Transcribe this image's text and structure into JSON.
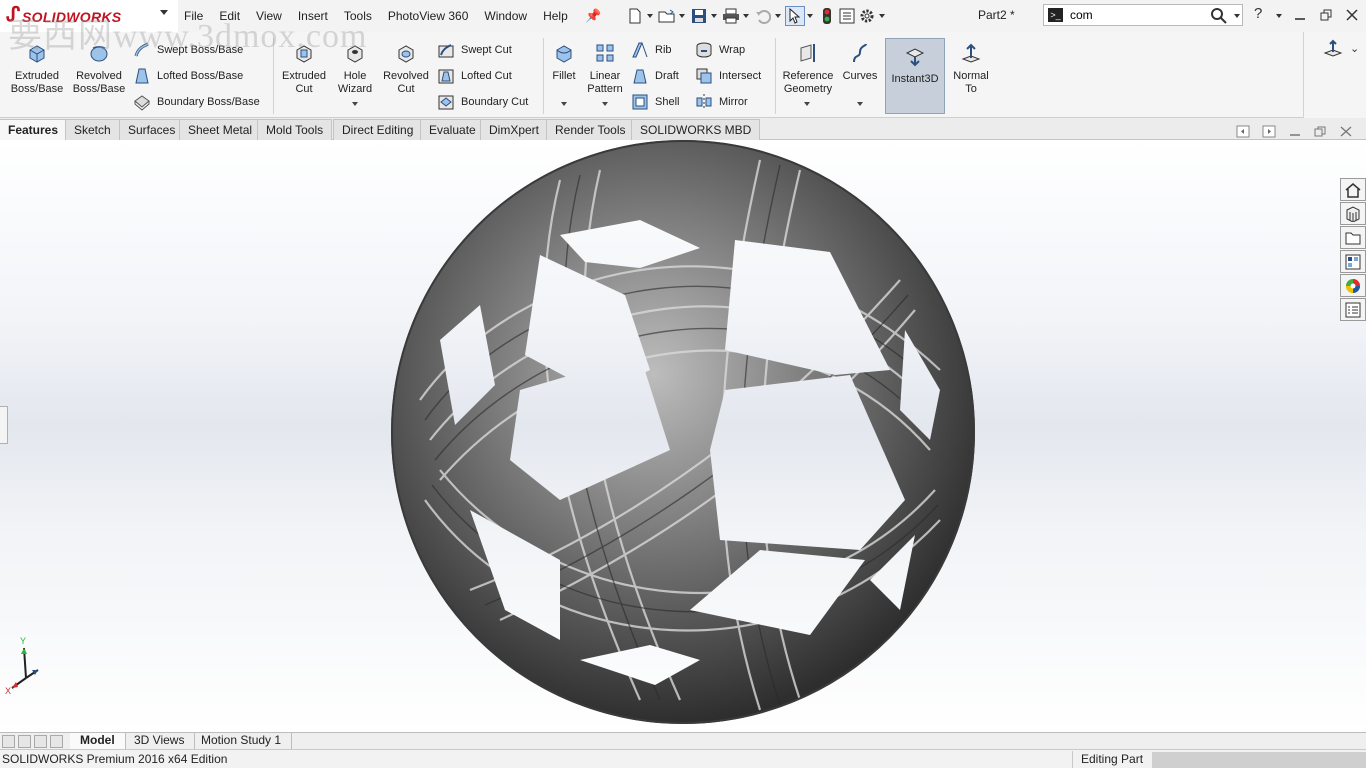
{
  "app": {
    "brand": "SOLIDWORKS",
    "menu": [
      "File",
      "Edit",
      "View",
      "Insert",
      "Tools",
      "PhotoView 360",
      "Window",
      "Help"
    ],
    "document_title": "Part2 *",
    "search_value": "com"
  },
  "ribbon": {
    "features": {
      "extruded_boss": "Extruded\nBoss/Base",
      "revolved_boss": "Revolved\nBoss/Base",
      "swept_boss": "Swept Boss/Base",
      "lofted_boss": "Lofted Boss/Base",
      "boundary_boss": "Boundary Boss/Base",
      "extruded_cut": "Extruded\nCut",
      "hole_wizard": "Hole\nWizard",
      "revolved_cut": "Revolved\nCut",
      "swept_cut": "Swept Cut",
      "lofted_cut": "Lofted Cut",
      "boundary_cut": "Boundary Cut",
      "fillet": "Fillet",
      "linear_pattern": "Linear\nPattern",
      "rib": "Rib",
      "draft": "Draft",
      "shell": "Shell",
      "wrap": "Wrap",
      "intersect": "Intersect",
      "mirror": "Mirror",
      "reference_geometry": "Reference\nGeometry",
      "curves": "Curves",
      "instant3d": "Instant3D",
      "normal_to": "Normal\nTo"
    }
  },
  "tabs": [
    "Features",
    "Sketch",
    "Surfaces",
    "Sheet Metal",
    "Mold Tools",
    "Direct Editing",
    "Evaluate",
    "DimXpert",
    "Render Tools",
    "SOLIDWORKS MBD"
  ],
  "active_tab": "Features",
  "bottom_tabs": [
    "Model",
    "3D Views",
    "Motion Study 1"
  ],
  "active_bottom_tab": "Model",
  "status": {
    "edition": "SOLIDWORKS Premium 2016 x64 Edition",
    "mode": "Editing Part"
  },
  "triad": {
    "y_label": "Y",
    "x_label": "X"
  },
  "watermark": "要西网www.3dmox.com",
  "colors": {
    "brand_red": "#c1121f",
    "instant3d_active": "#c7d0da",
    "model_gray": "#6e6e6e"
  }
}
